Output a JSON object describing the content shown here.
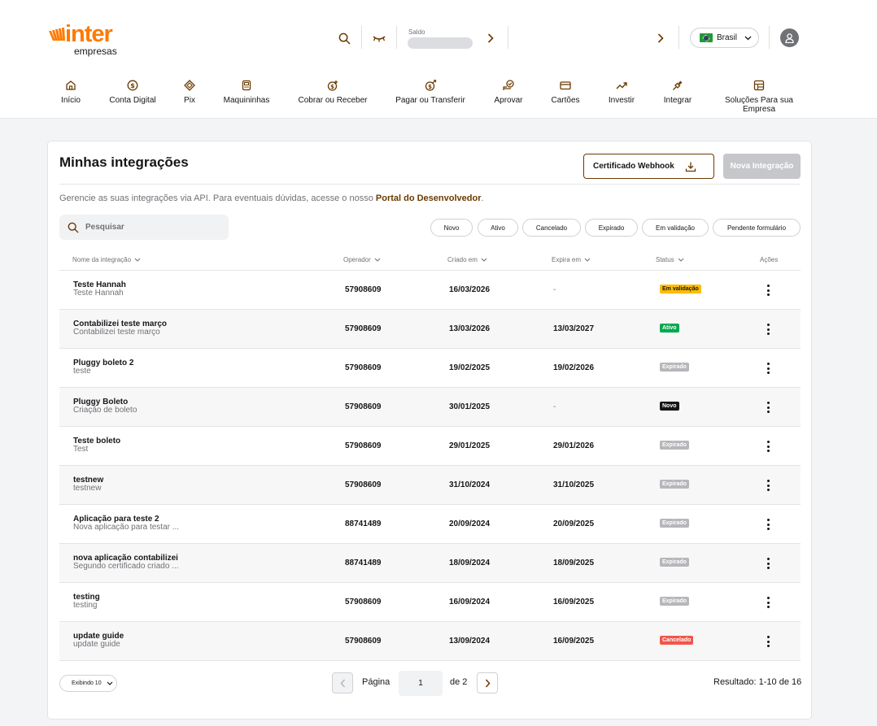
{
  "header": {
    "logo_brand": "inter",
    "logo_sub": "empresas",
    "saldo_label": "Saldo",
    "country": "Brasil"
  },
  "nav": [
    {
      "label": "Início",
      "icon": "home-icon"
    },
    {
      "label": "Conta Digital",
      "icon": "dollar-circle-icon"
    },
    {
      "label": "Pix",
      "icon": "pix-icon"
    },
    {
      "label": "Maquininhas",
      "icon": "pos-machine-icon"
    },
    {
      "label": "Cobrar ou Receber",
      "icon": "receive-money-icon"
    },
    {
      "label": "Pagar ou Transferir",
      "icon": "transfer-money-icon"
    },
    {
      "label": "Aprovar",
      "icon": "approve-icon"
    },
    {
      "label": "Cartões",
      "icon": "card-icon"
    },
    {
      "label": "Investir",
      "icon": "trend-up-icon"
    },
    {
      "label": "Integrar",
      "icon": "plug-icon"
    },
    {
      "label": "Soluções Para sua Empresa",
      "icon": "grid-icon"
    }
  ],
  "page": {
    "title": "Minhas integrações",
    "webhook_button": "Certificado Webhook",
    "new_button": "Nova Integração",
    "description_prefix": "Gerencie as suas integrações via API. Para eventuais dúvidas, acesse o nosso ",
    "description_link": "Portal do Desenvolvedor",
    "description_suffix": ".",
    "search_placeholder": "Pesquisar"
  },
  "filters": [
    "Novo",
    "Ativo",
    "Cancelado",
    "Expirado",
    "Em validação",
    "Pendente formulário"
  ],
  "columns": {
    "name": "Nome da integração",
    "operator": "Operador",
    "created": "Criado em",
    "expires": "Expira em",
    "status": "Status",
    "actions": "Ações"
  },
  "rows": [
    {
      "name": "Teste Hannah",
      "desc": "Teste Hannah",
      "operator": "57908609",
      "created": "16/03/2026",
      "expires": "-",
      "status": "Em validação"
    },
    {
      "name": "Contabilizei teste março",
      "desc": "Contabilizei teste março",
      "operator": "57908609",
      "created": "13/03/2026",
      "expires": "13/03/2027",
      "status": "Ativo"
    },
    {
      "name": "Pluggy boleto 2",
      "desc": "teste",
      "operator": "57908609",
      "created": "19/02/2025",
      "expires": "19/02/2026",
      "status": "Expirado"
    },
    {
      "name": "Pluggy Boleto",
      "desc": "Criação de boleto",
      "operator": "57908609",
      "created": "30/01/2025",
      "expires": "-",
      "status": "Novo"
    },
    {
      "name": "Teste boleto",
      "desc": "Test",
      "operator": "57908609",
      "created": "29/01/2025",
      "expires": "29/01/2026",
      "status": "Expirado"
    },
    {
      "name": "testnew",
      "desc": "testnew",
      "operator": "57908609",
      "created": "31/10/2024",
      "expires": "31/10/2025",
      "status": "Expirado"
    },
    {
      "name": "Aplicação para teste 2",
      "desc": "Nova aplicação para testar ...",
      "operator": "88741489",
      "created": "20/09/2024",
      "expires": "20/09/2025",
      "status": "Expirado"
    },
    {
      "name": "nova aplicação contabilizei",
      "desc": "Segundo certificado criado ...",
      "operator": "88741489",
      "created": "18/09/2024",
      "expires": "18/09/2025",
      "status": "Expirado"
    },
    {
      "name": "testing",
      "desc": "testing",
      "operator": "57908609",
      "created": "16/09/2024",
      "expires": "16/09/2025",
      "status": "Expirado"
    },
    {
      "name": "update guide",
      "desc": "update guide",
      "operator": "57908609",
      "created": "13/09/2024",
      "expires": "16/09/2025",
      "status": "Cancelado"
    }
  ],
  "status_colors": {
    "Em validação": {
      "bg": "#ffbc00",
      "fg": "#161616"
    },
    "Ativo": {
      "bg": "#00aa4f",
      "fg": "#ffffff"
    },
    "Expirado": {
      "bg": "#b6b7ba",
      "fg": "#ffffff"
    },
    "Novo": {
      "bg": "#161616",
      "fg": "#ffffff"
    },
    "Cancelado": {
      "bg": "#f1564a",
      "fg": "#ffffff"
    }
  },
  "footer": {
    "page_size": "Exibindo 10",
    "page_label": "Página",
    "page_current": "1",
    "page_total": "de 2",
    "result": "Resultado: 1-10 de 16"
  }
}
